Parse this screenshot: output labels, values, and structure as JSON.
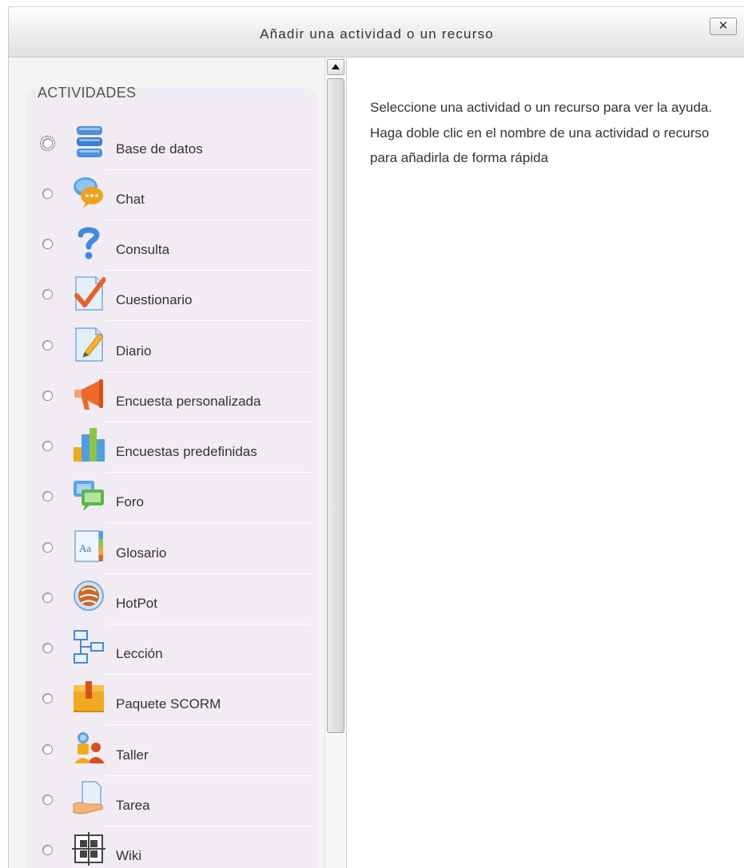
{
  "dialog": {
    "title": "Añadir una actividad o un recurso",
    "close_label": "✕"
  },
  "activities": {
    "section_title": "ACTIVIDADES",
    "items": [
      {
        "label": "Base de datos",
        "icon": "database-icon"
      },
      {
        "label": "Chat",
        "icon": "chat-icon"
      },
      {
        "label": "Consulta",
        "icon": "question-icon"
      },
      {
        "label": "Cuestionario",
        "icon": "quiz-icon"
      },
      {
        "label": "Diario",
        "icon": "journal-icon"
      },
      {
        "label": "Encuesta personalizada",
        "icon": "megaphone-icon"
      },
      {
        "label": "Encuestas predefinidas",
        "icon": "bar-chart-icon"
      },
      {
        "label": "Foro",
        "icon": "forum-icon"
      },
      {
        "label": "Glosario",
        "icon": "glossary-icon"
      },
      {
        "label": "HotPot",
        "icon": "hotpot-icon"
      },
      {
        "label": "Lección",
        "icon": "lesson-icon"
      },
      {
        "label": "Paquete SCORM",
        "icon": "package-icon"
      },
      {
        "label": "Taller",
        "icon": "workshop-icon"
      },
      {
        "label": "Tarea",
        "icon": "assignment-icon"
      },
      {
        "label": "Wiki",
        "icon": "wiki-icon"
      }
    ]
  },
  "help": {
    "text": "Seleccione una actividad o un recurso para ver la ayuda. Haga doble clic en el nombre de una actividad o recurso para añadirla de forma rápida"
  }
}
